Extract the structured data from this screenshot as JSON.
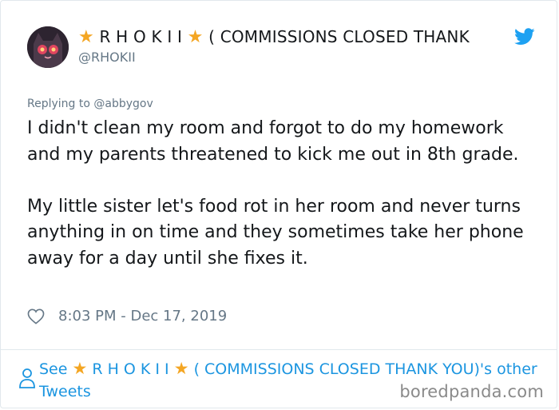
{
  "author": {
    "display_name_prefix": "★",
    "display_name_main": " R H O K I I ",
    "display_name_star2": "★",
    "display_name_suffix": " ( COMMISSIONS CLOSED THANK",
    "handle": "@RHOKII"
  },
  "reply": {
    "prefix": "Replying to ",
    "mention": "@abbygov"
  },
  "tweet": {
    "paragraph_1": "I didn't clean my room and forgot to do my homework and my parents threatened to kick me out in 8th grade.",
    "paragraph_2": "My little sister let's food rot in her room and never turns anything in on time and they sometimes take her phone away for a day until she fixes it."
  },
  "meta": {
    "timestamp": "8:03 PM - Dec 17, 2019"
  },
  "footer": {
    "see": "See ",
    "star1": "★",
    "name": " R H O K I I ",
    "star2": "★",
    "suffix": " ( COMMISSIONS CLOSED THANK YOU)'s other Tweets"
  },
  "watermark": "boredpanda.com",
  "colors": {
    "link": "#1b95e0",
    "secondary_text": "#657786",
    "star": "#f4a623",
    "twitter_blue": "#1da1f2"
  },
  "icons": [
    "avatar-cat",
    "twitter-bird-icon",
    "heart-icon",
    "person-icon",
    "star-emoji"
  ]
}
